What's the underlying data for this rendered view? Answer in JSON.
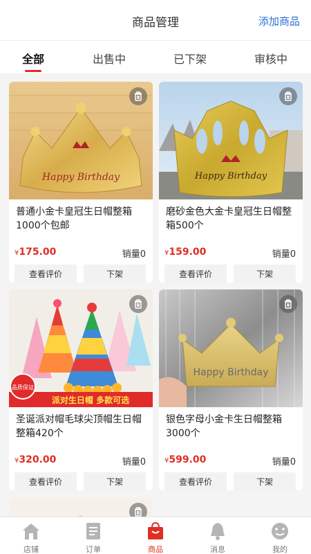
{
  "header": {
    "title": "商品管理",
    "add_label": "添加商品"
  },
  "tabs": [
    {
      "label": "全部"
    },
    {
      "label": "出售中"
    },
    {
      "label": "已下架"
    },
    {
      "label": "审核中"
    }
  ],
  "card_actions": {
    "review_label": "查看评价",
    "offshelf_label": "下架"
  },
  "products": [
    {
      "name": "普通小金卡皇冠生日帽整箱1000个包邮",
      "currency": "¥",
      "price": "175.00",
      "stock": "销量0",
      "image_text": "Happy Birthday"
    },
    {
      "name": "磨砂金色大金卡皇冠生日帽整箱500个",
      "currency": "¥",
      "price": "159.00",
      "stock": "销量0",
      "image_text": "Happy Birthday"
    },
    {
      "name": "圣诞派对帽毛球尖顶帽生日帽整箱420个",
      "currency": "¥",
      "price": "320.00",
      "stock": "销量0",
      "image_text": "派对生日帽 多款可选",
      "badge_text": "品质保证"
    },
    {
      "name": "银色字母小金卡生日帽整箱3000个",
      "currency": "¥",
      "price": "599.00",
      "stock": "销量0",
      "image_text": "Happy Birthday"
    }
  ],
  "bottom_nav": [
    {
      "label": "店铺",
      "icon": "home-icon"
    },
    {
      "label": "订单",
      "icon": "order-icon"
    },
    {
      "label": "商品",
      "icon": "shopping-bag-icon"
    },
    {
      "label": "消息",
      "icon": "bell-icon"
    },
    {
      "label": "我的",
      "icon": "face-icon"
    }
  ],
  "colors": {
    "accent": "#e02e24",
    "link": "#2b6fd6"
  }
}
